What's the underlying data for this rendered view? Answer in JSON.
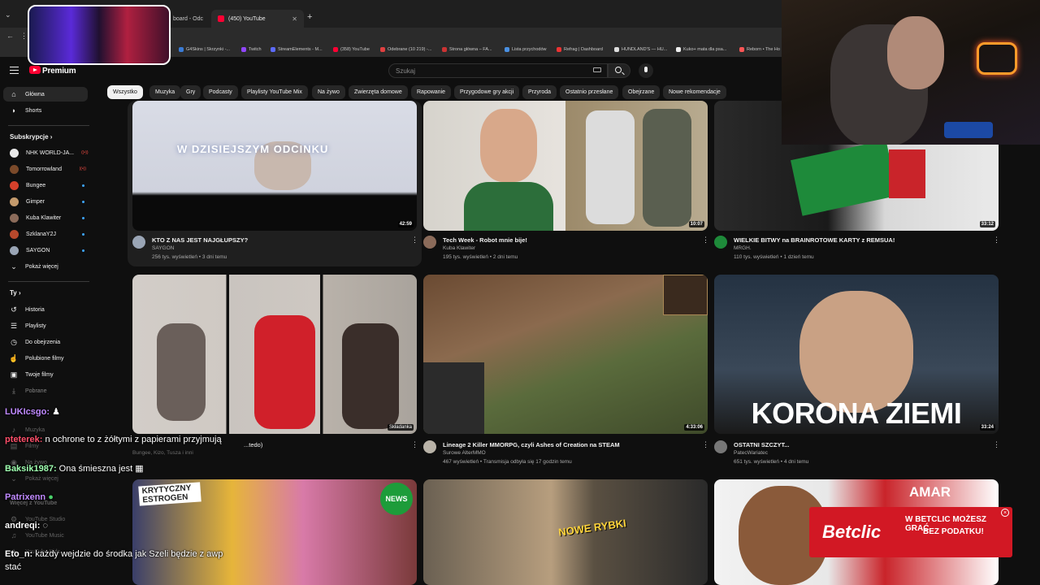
{
  "browser": {
    "tabs": [
      {
        "label": "board - Odc"
      },
      {
        "label": "(450) YouTube"
      }
    ],
    "bookmarks": [
      "G4Skins | Skrzynki -...",
      "Twitch",
      "StreamElements - M...",
      "(358) YouTube",
      "Odebrane (10 219) -...",
      "Strona główna – FA...",
      "Lista przychodów",
      "Refrag | Dashboard",
      "HUNDLAND'S — HU...",
      "Kuko+ mata dla psa...",
      "Reborn • The Ho"
    ]
  },
  "header": {
    "brand": "Premium",
    "search_placeholder": "Szukaj"
  },
  "chips": [
    "Wszystko",
    "Muzyka",
    "Gry",
    "Podcasty",
    "Playlisty YouTube Mix",
    "Na żywo",
    "Zwierzęta domowe",
    "Rapowanie",
    "Przygodowe gry akcji",
    "Przyroda",
    "Ostatnio przesłane",
    "Obejrzane",
    "Nowe rekomendacje"
  ],
  "sidebar": {
    "main": [
      {
        "label": "Główna"
      },
      {
        "label": "Shorts"
      }
    ],
    "subscriptions_heading": "Subskrypcje",
    "subscriptions": [
      {
        "label": "NHK WORLD-JA...",
        "status": "live"
      },
      {
        "label": "Tomorrowland",
        "status": "live"
      },
      {
        "label": "Bungee",
        "status": "dot"
      },
      {
        "label": "Gimper",
        "status": "dot"
      },
      {
        "label": "Kuba Klawiter",
        "status": "dot"
      },
      {
        "label": "SzklanaY2J",
        "status": "dot"
      },
      {
        "label": "SAYGON",
        "status": "dot"
      }
    ],
    "show_more": "Pokaż więcej",
    "you_heading": "Ty",
    "you": [
      {
        "label": "Historia"
      },
      {
        "label": "Playlisty"
      },
      {
        "label": "Do obejrzenia"
      },
      {
        "label": "Polubione filmy"
      },
      {
        "label": "Twoje filmy"
      },
      {
        "label": "Pobrane"
      }
    ],
    "faded": [
      "Muzyka",
      "Filmy",
      "Na żywo",
      "Pokaż więcej",
      "Więcej z YouTube",
      "YouTube Studio",
      "YouTube Music",
      "YouTube Kids"
    ]
  },
  "videos": [
    {
      "overlay_text": "W DZISIEJSZYM ODCINKU",
      "title": "KTO Z NAS JEST NAJGŁUPSZY?",
      "channel": "SAYGON",
      "meta": "256 tys. wyświetleń • 3 dni temu",
      "duration": "42:59"
    },
    {
      "title": "Tech Week - Robot mnie bije!",
      "channel": "Kuba Klawiter",
      "meta": "195 tys. wyświetleń • 2 dni temu",
      "duration": "10:07"
    },
    {
      "title": "WIELKIE BITWY na BRAINROTOWE KARTY z REMSUA!",
      "channel": "MRGH.",
      "meta": "110 tys. wyświetleń • 1 dzień temu",
      "duration": "33:12"
    },
    {
      "title": "...tedo)",
      "channel": "Bungee, Kizo, Tusza i inni",
      "meta": "",
      "duration": "",
      "badge": "Składanka"
    },
    {
      "title": "Lineage 2 Killer MMORPG, czyli Ashes of Creation na STEAM",
      "channel": "Surowe AlterMMO",
      "meta": "467 wyświetleń • Transmisja odbyła się 17 godzin temu",
      "duration": "4:33:06"
    },
    {
      "overlay_text": "KORONA ZIEMI",
      "title": "OSTATNI SZCZYT...",
      "channel": "PatecWariatec",
      "meta": "651 tys. wyświetleń • 4 dni temu",
      "duration": "33:24"
    },
    {
      "overlay_text": "KRYTYCZNY ESTROGEN",
      "badge": "NEWS"
    },
    {
      "overlay_text": "NOWE RYBKI"
    },
    {
      "overlay_text": "AMAR"
    }
  ],
  "chat": [
    {
      "user": "LUKIcsgo:",
      "message": "",
      "user_color": "#c08aff"
    },
    {
      "user": "pteterek:",
      "message": "n ochrone to z żółtymi z papierami przyjmują",
      "user_color": "#ff4f6a"
    },
    {
      "user": "Baksik1987:",
      "message": "Ona śmieszna jest",
      "user_color": "#9fffb0"
    },
    {
      "user": "Patrixenn",
      "message": "",
      "user_color": "#c08aff"
    },
    {
      "user": "andreqi:",
      "message": "",
      "user_color": "#ffffff"
    },
    {
      "user": "Eto_n:",
      "message": "każdy wejdzie do środka jak Szeli będzie z awp",
      "user_color": "#ffffff"
    },
    {
      "user": "",
      "message": "stać",
      "user_color": "#ffffff"
    }
  ],
  "ad": {
    "brand": "Betclic",
    "line1": "W BETCLIC MOŻESZ GRAĆ",
    "line2": "BEZ PODATKU!"
  },
  "colors": {
    "background": "#0f0f0f",
    "chip_active": "#f1f1f1",
    "brand_red": "#ff0033",
    "ad_red": "#d21824"
  }
}
